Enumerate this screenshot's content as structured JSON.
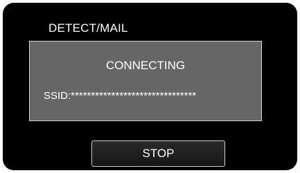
{
  "header": {
    "title": "DETECT/MAIL"
  },
  "dialog": {
    "status": "CONNECTING",
    "ssid": "SSID:*******************************"
  },
  "actions": {
    "stop_label": "STOP"
  },
  "colors": {
    "screen_background": "#000000",
    "dialog_background": "#666666",
    "dialog_border": "#d8d8d8",
    "text": "#ffffff"
  }
}
